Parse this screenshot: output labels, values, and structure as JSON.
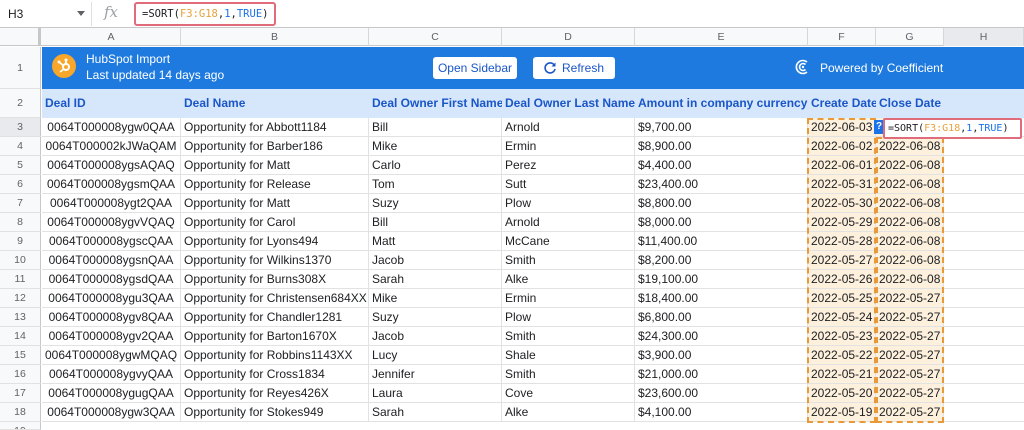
{
  "formula_bar": {
    "name_box": "H3",
    "fx": "fx",
    "formula_parts": [
      "=SORT(",
      "F3:G18",
      ",",
      "1",
      ",",
      "TRUE",
      ")"
    ]
  },
  "columns": [
    "A",
    "B",
    "C",
    "D",
    "E",
    "F",
    "G",
    "H"
  ],
  "row_numbers": [
    "1",
    "2",
    "3",
    "4",
    "5",
    "6",
    "7",
    "8",
    "9",
    "10",
    "11",
    "12",
    "13",
    "14",
    "15",
    "16",
    "17",
    "18",
    "19"
  ],
  "banner": {
    "title": "HubSpot Import",
    "subtitle": "Last updated 14 days ago",
    "open_sidebar": "Open Sidebar",
    "refresh": "Refresh",
    "powered_by": "Powered by Coefficient",
    "colors": {
      "banner": "#1f7ae0",
      "logo": "#f8a72a"
    }
  },
  "headers": [
    "Deal ID",
    "Deal Name",
    "Deal Owner First Name",
    "Deal Owner Last Name",
    "Amount in company currency",
    "Create Date",
    "Close Date"
  ],
  "rows": [
    [
      "0064T000008ygw0QAA",
      "Opportunity for Abbott1184",
      "Bill",
      "Arnold",
      "$9,700.00",
      "2022-06-03",
      ""
    ],
    [
      "0064T000002kJWaQAM",
      "Opportunity for Barber186",
      "Mike",
      "Ermin",
      "$8,900.00",
      "2022-06-02",
      "2022-06-08"
    ],
    [
      "0064T000008ygsAQAQ",
      "Opportunity for Matt",
      "Carlo",
      "Perez",
      "$4,400.00",
      "2022-06-01",
      "2022-06-08"
    ],
    [
      "0064T000008ygsmQAA",
      "Opportunity for Release",
      "Tom",
      "Sutt",
      "$23,400.00",
      "2022-05-31",
      "2022-06-08"
    ],
    [
      "0064T000008ygt2QAA",
      "Opportunity for Matt",
      "Suzy",
      "Plow",
      "$8,800.00",
      "2022-05-30",
      "2022-06-08"
    ],
    [
      "0064T000008ygvVQAQ",
      "Opportunity for Carol",
      "Bill",
      "Arnold",
      "$8,000.00",
      "2022-05-29",
      "2022-06-08"
    ],
    [
      "0064T000008ygscQAA",
      "Opportunity for Lyons494",
      "Matt",
      "McCane",
      "$11,400.00",
      "2022-05-28",
      "2022-06-08"
    ],
    [
      "0064T000008ygsnQAA",
      "Opportunity for Wilkins1370",
      "Jacob",
      "Smith",
      "$8,200.00",
      "2022-05-27",
      "2022-06-08"
    ],
    [
      "0064T000008ygsdQAA",
      "Opportunity for Burns308X",
      "Sarah",
      "Alke",
      "$19,100.00",
      "2022-05-26",
      "2022-06-08"
    ],
    [
      "0064T000008ygu3QAA",
      "Opportunity for Christensen684XX",
      "Mike",
      "Ermin",
      "$18,400.00",
      "2022-05-25",
      "2022-05-27"
    ],
    [
      "0064T000008ygv8QAA",
      "Opportunity for Chandler1281",
      "Suzy",
      "Plow",
      "$6,800.00",
      "2022-05-24",
      "2022-05-27"
    ],
    [
      "0064T000008ygv2QAA",
      "Opportunity for Barton1670X",
      "Jacob",
      "Smith",
      "$24,300.00",
      "2022-05-23",
      "2022-05-27"
    ],
    [
      "0064T000008ygwMQAQ",
      "Opportunity for Robbins1143XX",
      "Lucy",
      "Shale",
      "$3,900.00",
      "2022-05-22",
      "2022-05-27"
    ],
    [
      "0064T000008ygvyQAA",
      "Opportunity for Cross1834",
      "Jennifer",
      "Smith",
      "$21,000.00",
      "2022-05-21",
      "2022-05-27"
    ],
    [
      "0064T000008ygugQAA",
      "Opportunity for Reyes426X",
      "Laura",
      "Cove",
      "$23,600.00",
      "2022-05-20",
      "2022-05-27"
    ],
    [
      "0064T000008ygw3QAA",
      "Opportunity for Stokes949",
      "Sarah",
      "Alke",
      "$4,100.00",
      "2022-05-19",
      "2022-05-27"
    ]
  ],
  "cell_popup": {
    "badge": "?"
  }
}
